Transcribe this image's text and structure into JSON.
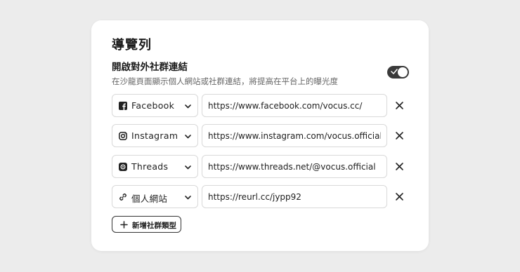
{
  "section": {
    "title": "導覽列",
    "social_toggle_label": "開啟對外社群連結",
    "social_toggle_description": "在沙龍頁面顯示個人網站或社群連結，將提高在平台上的曝光度",
    "social_toggle_on": true
  },
  "links": [
    {
      "platform": "Facebook",
      "icon": "facebook-icon",
      "url": "https://www.facebook.com/vocus.cc/"
    },
    {
      "platform": "Instagram",
      "icon": "instagram-icon",
      "url": "https://www.instagram.com/vocus.official/"
    },
    {
      "platform": "Threads",
      "icon": "threads-icon",
      "url": "https://www.threads.net/@vocus.official"
    },
    {
      "platform": "個人網站",
      "icon": "link-icon",
      "url": "https://reurl.cc/jypp92"
    }
  ],
  "add_button_label": "新增社群類型",
  "colors": {
    "toggle_on": "#3a3a3a",
    "border": "#d9d9d9",
    "background": "#ececec"
  }
}
